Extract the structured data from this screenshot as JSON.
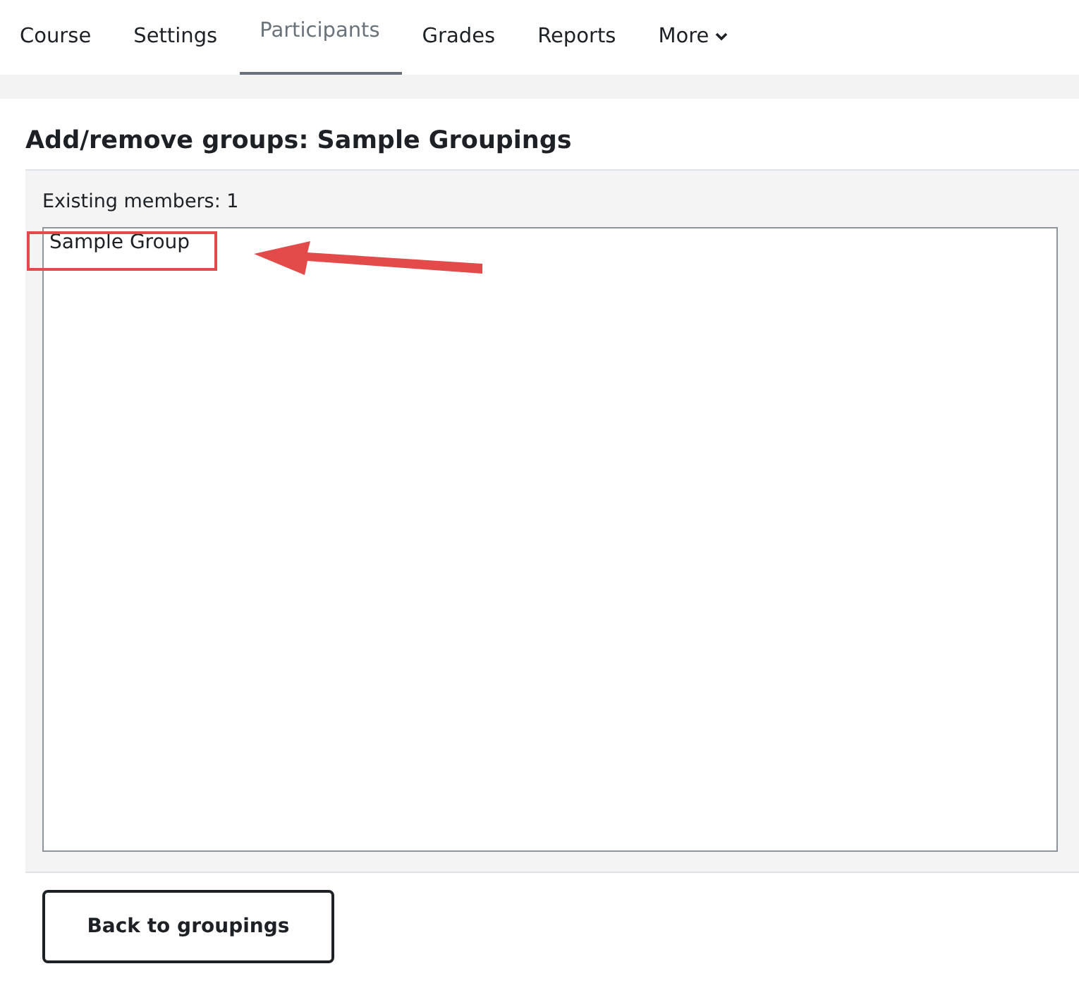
{
  "tabs": [
    {
      "label": "Course",
      "selected": false
    },
    {
      "label": "Settings",
      "selected": false
    },
    {
      "label": "Participants",
      "selected": true
    },
    {
      "label": "Grades",
      "selected": false
    },
    {
      "label": "Reports",
      "selected": false
    },
    {
      "label": "More",
      "selected": false,
      "kind": "dropdown"
    }
  ],
  "heading": "Add/remove groups: Sample Groupings",
  "members_label": "Existing members: 1",
  "members": [
    {
      "label": "Sample Group",
      "highlighted": true
    }
  ],
  "back_button": "Back to groupings"
}
